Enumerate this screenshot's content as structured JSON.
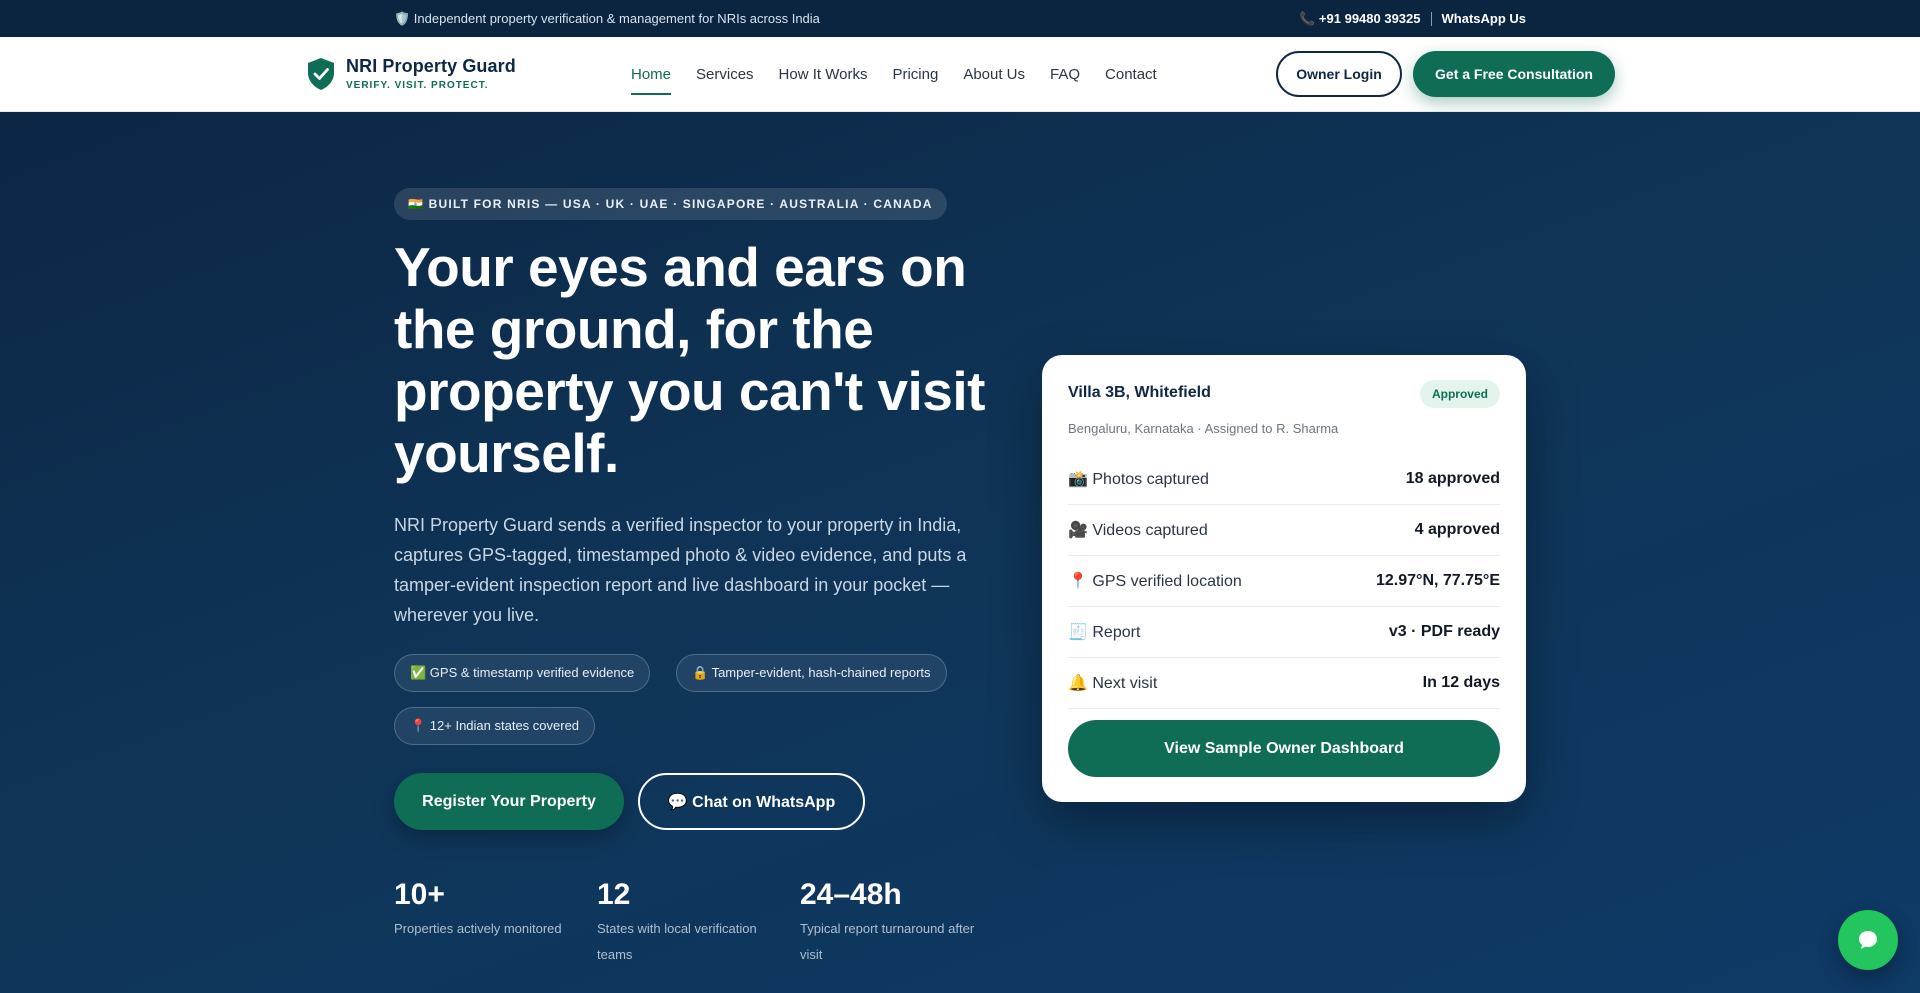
{
  "topbar": {
    "tagline": "🛡️ Independent property verification & management for NRIs across India",
    "phone": "📞 +91 99480 39325",
    "whatsapp": "WhatsApp Us"
  },
  "brand": {
    "name": "NRI Property Guard",
    "tagline": "VERIFY. VISIT. PROTECT."
  },
  "nav": {
    "items": [
      {
        "label": "Home"
      },
      {
        "label": "Services"
      },
      {
        "label": "How It Works"
      },
      {
        "label": "Pricing"
      },
      {
        "label": "About Us"
      },
      {
        "label": "FAQ"
      },
      {
        "label": "Contact"
      }
    ],
    "active": "Home"
  },
  "header_actions": {
    "login": "Owner Login",
    "consult": "Get a Free Consultation"
  },
  "hero": {
    "badge": "🇮🇳 BUILT FOR NRIS — USA · UK · UAE · SINGAPORE · AUSTRALIA · CANADA",
    "headline": "Your eyes and ears on the ground, for the property you can't visit yourself.",
    "subtext": "NRI Property Guard sends a verified inspector to your property in India, captures GPS-tagged, timestamped photo & video evidence, and puts a tamper-evident inspection report and live dashboard in your pocket — wherever you live.",
    "chips": [
      "✅ GPS & timestamp verified evidence",
      "🔒 Tamper-evident, hash-chained reports",
      "📍 12+ Indian states covered"
    ],
    "cta_primary": "Register Your Property",
    "cta_secondary": "💬 Chat on WhatsApp",
    "stats": [
      {
        "value": "10+",
        "label": "Properties actively monitored"
      },
      {
        "value": "12",
        "label": "States with local verification teams"
      },
      {
        "value": "24–48h",
        "label": "Typical report turnaround after visit"
      }
    ]
  },
  "card": {
    "title": "Villa 3B, Whitefield",
    "status": "Approved",
    "subtitle": "Bengaluru, Karnataka · Assigned to R. Sharma",
    "rows": [
      {
        "label": "📸 Photos captured",
        "value": "18 approved"
      },
      {
        "label": "🎥 Videos captured",
        "value": "4 approved"
      },
      {
        "label": "📍 GPS verified location",
        "value": "12.97°N, 77.75°E"
      },
      {
        "label": "🧾 Report",
        "value": "v3 · PDF ready"
      },
      {
        "label": "🔔 Next visit",
        "value": "In 12 days"
      }
    ],
    "button": "View Sample Owner Dashboard"
  },
  "colors": {
    "brand_green": "#0f6d55",
    "navy": "#0f2744",
    "whatsapp_green": "#22c55e"
  },
  "icons": {
    "logo": "shield-check-icon",
    "fab": "chat-bubble-icon"
  }
}
